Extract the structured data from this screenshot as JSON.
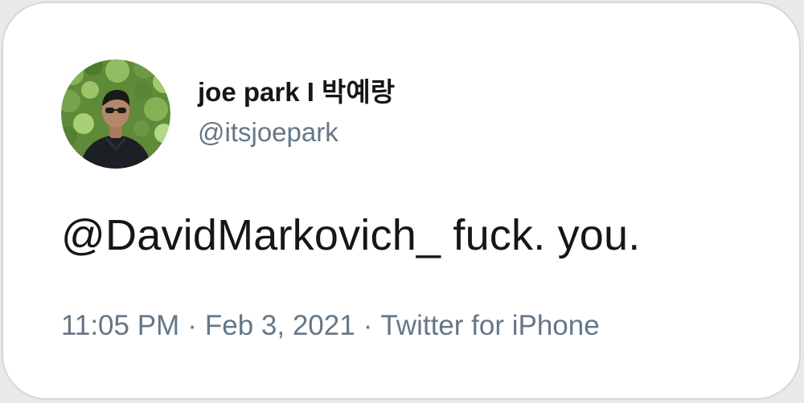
{
  "tweet": {
    "author": {
      "display_name": "joe park I 박예랑",
      "handle": "@itsjoepark",
      "avatar_icon": "profile-photo"
    },
    "text": "@DavidMarkovich_ fuck. you.",
    "time": "11:05 PM",
    "date": "Feb 3, 2021",
    "source": "Twitter for iPhone",
    "separator": "·"
  },
  "colors": {
    "text_primary": "#14171a",
    "text_secondary": "#657786",
    "card_bg": "#ffffff",
    "card_border": "#d7d7d7"
  }
}
